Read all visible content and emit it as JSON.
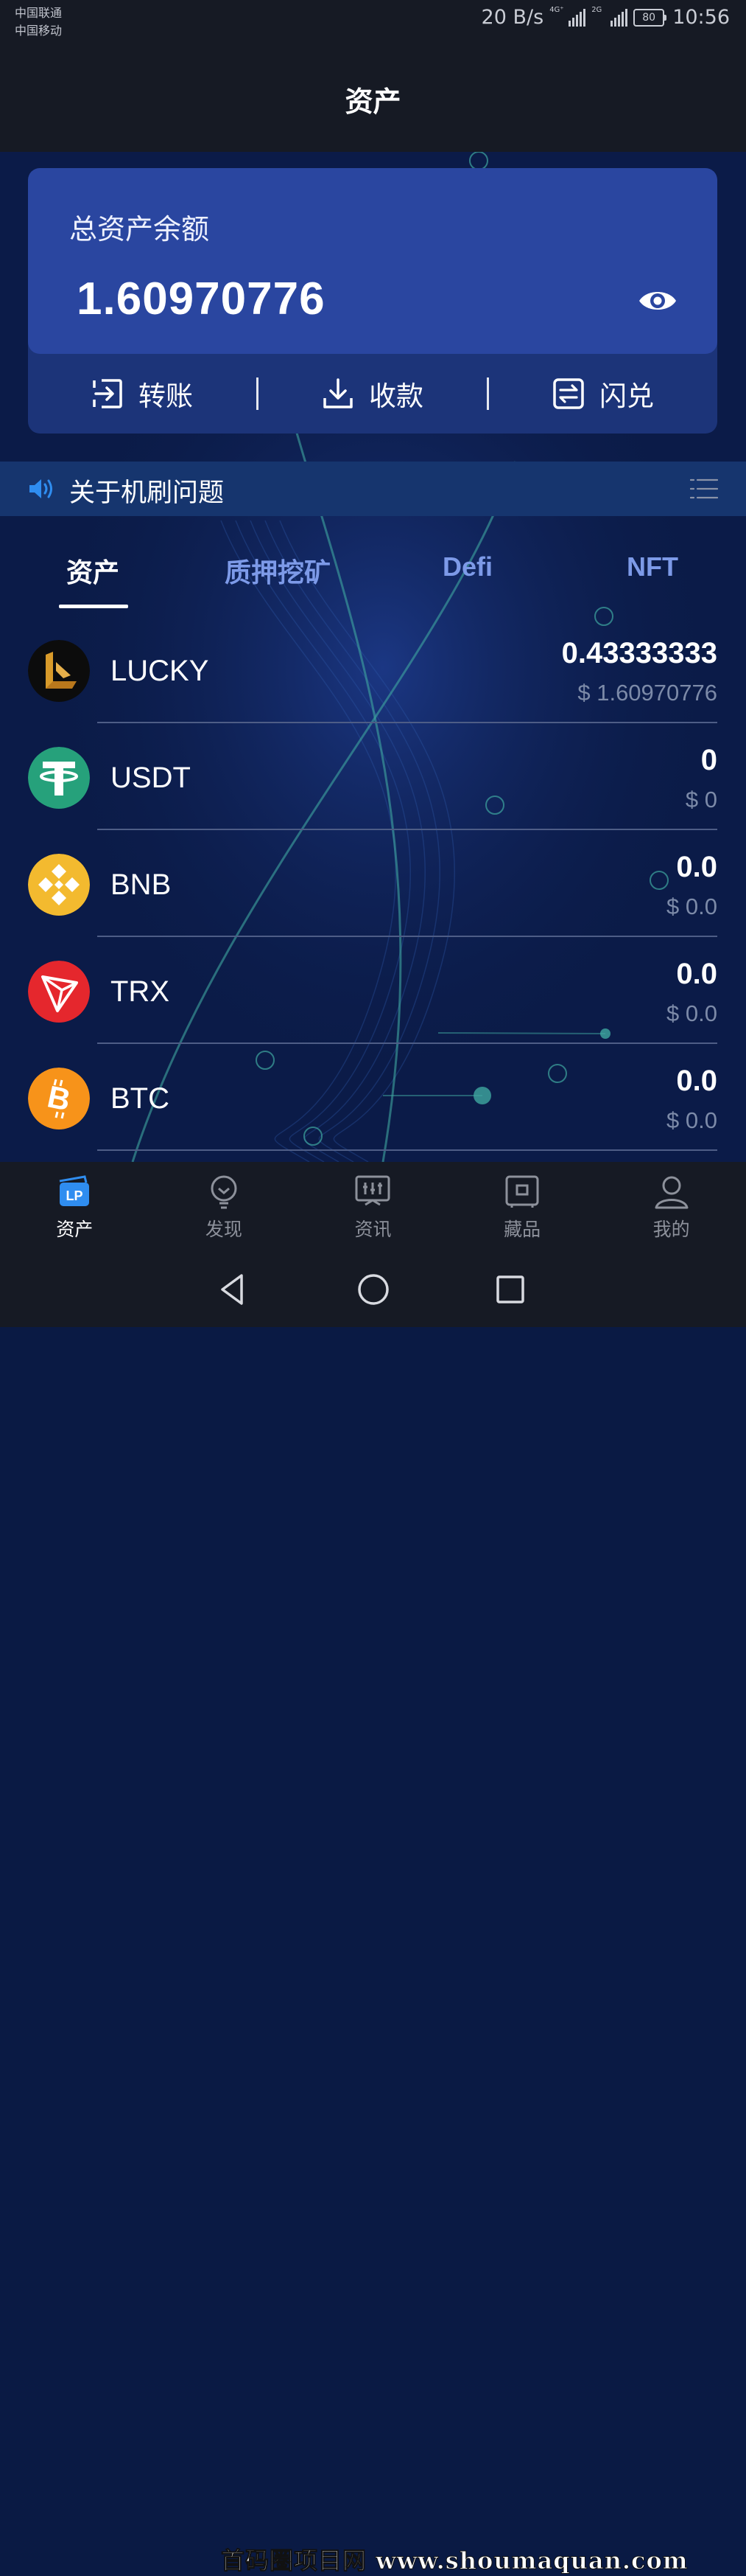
{
  "status_bar": {
    "carrier1": "中国联通",
    "carrier2": "中国移动",
    "speed": "20 B/s",
    "network1": "4G⁺",
    "network2": "2G",
    "battery": "80",
    "time": "10:56"
  },
  "header": {
    "title": "资产"
  },
  "balance": {
    "label": "总资产余额",
    "value": "1.60970776"
  },
  "actions": [
    {
      "label": "转账",
      "icon": "transfer-icon"
    },
    {
      "label": "收款",
      "icon": "download-icon"
    },
    {
      "label": "闪兑",
      "icon": "swap-icon"
    }
  ],
  "notice": {
    "text": "关于机刷问题",
    "icon": "speaker-icon"
  },
  "tabs": [
    {
      "label": "资产",
      "active": true
    },
    {
      "label": "质押挖矿",
      "active": false
    },
    {
      "label": "Defi",
      "active": false
    },
    {
      "label": "NFT",
      "active": false
    }
  ],
  "assets": [
    {
      "name": "LUCKY",
      "amount": "0.43333333",
      "fiat": "$ 1.60970776",
      "icon": "lucky-coin-icon",
      "color": "#0c0c0c"
    },
    {
      "name": "USDT",
      "amount": "0",
      "fiat": "$ 0",
      "icon": "usdt-coin-icon",
      "color": "#26a17b"
    },
    {
      "name": "BNB",
      "amount": "0.0",
      "fiat": "$ 0.0",
      "icon": "bnb-coin-icon",
      "color": "#f3ba2f"
    },
    {
      "name": "TRX",
      "amount": "0.0",
      "fiat": "$ 0.0",
      "icon": "trx-coin-icon",
      "color": "#e5272d"
    },
    {
      "name": "BTC",
      "amount": "0.0",
      "fiat": "$ 0.0",
      "icon": "btc-coin-icon",
      "color": "#f7931a"
    }
  ],
  "bottom_nav": [
    {
      "label": "资产",
      "icon": "wallet-lp-icon",
      "active": true
    },
    {
      "label": "发现",
      "icon": "bulb-icon",
      "active": false
    },
    {
      "label": "资讯",
      "icon": "news-icon",
      "active": false
    },
    {
      "label": "藏品",
      "icon": "collection-icon",
      "active": false
    },
    {
      "label": "我的",
      "icon": "user-icon",
      "active": false
    }
  ],
  "watermark": "首码圈项目网 www.shoumaquan.com",
  "colors": {
    "background": "#0a1a44",
    "card": "#2a46a0",
    "card_actions": "#1c3479",
    "tab_inactive": "#7d9ae8",
    "bars": "#161a24"
  }
}
